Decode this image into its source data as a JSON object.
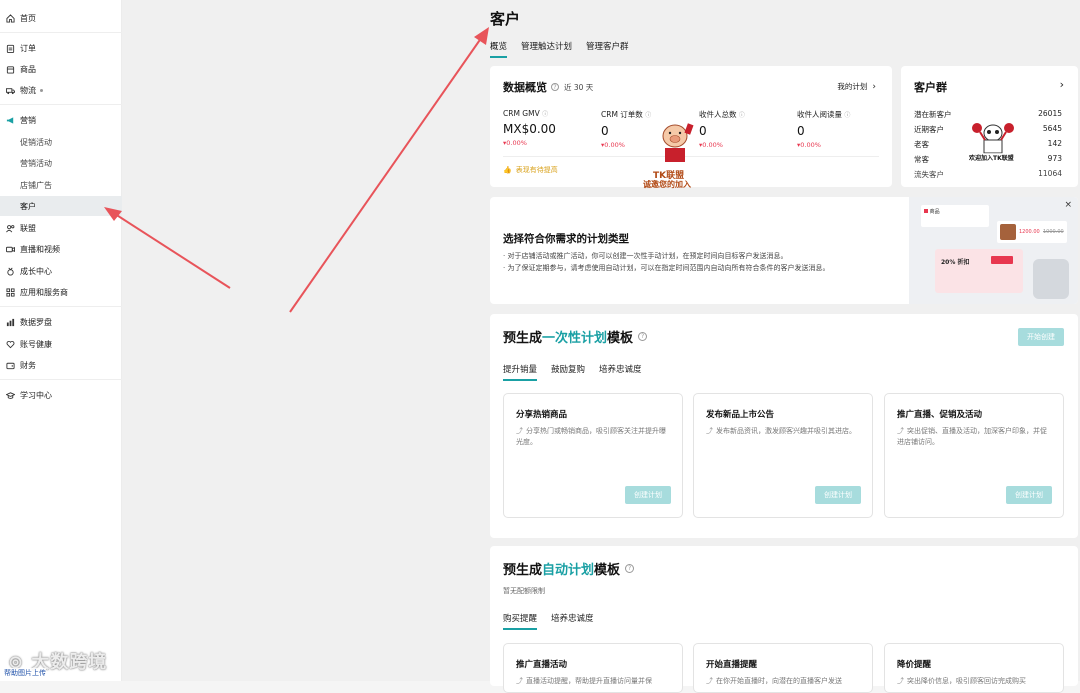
{
  "sidebar": {
    "items": [
      {
        "label": "首页",
        "icon": "home-icon"
      },
      {
        "label": "订单",
        "icon": "clipboard-icon"
      },
      {
        "label": "商品",
        "icon": "box-icon"
      },
      {
        "label": "物流",
        "icon": "truck-icon"
      },
      {
        "label": "营销",
        "icon": "megaphone-icon"
      },
      {
        "label": "促销活动"
      },
      {
        "label": "营销活动"
      },
      {
        "label": "店铺广告"
      },
      {
        "label": "客户"
      },
      {
        "label": "联盟",
        "icon": "users-icon"
      },
      {
        "label": "直播和视频",
        "icon": "video-icon"
      },
      {
        "label": "成长中心",
        "icon": "medal-icon"
      },
      {
        "label": "应用和服务商",
        "icon": "apps-icon"
      },
      {
        "label": "数据罗盘",
        "icon": "chart-icon"
      },
      {
        "label": "账号健康",
        "icon": "heart-icon"
      },
      {
        "label": "财务",
        "icon": "wallet-icon"
      },
      {
        "label": "学习中心",
        "icon": "graduation-cap-icon"
      }
    ]
  },
  "page": {
    "title": "客户",
    "tabs": [
      "概览",
      "管理触达计划",
      "管理客户群"
    ]
  },
  "overview": {
    "title": "数据概览",
    "range": "近 30 天",
    "my_plan": "我的计划",
    "metrics": [
      {
        "label": "CRM GMV",
        "value": "MX$0.00",
        "delta": "0.00%"
      },
      {
        "label": "CRM 订单数",
        "value": "0",
        "delta": "0.00%"
      },
      {
        "label": "收件人总数",
        "value": "0",
        "delta": "0.00%"
      },
      {
        "label": "收件人阅读量",
        "value": "0",
        "delta": "0.00%"
      }
    ],
    "improve_note": "表现有待提高"
  },
  "segments": {
    "title": "客户群",
    "rows": [
      {
        "label": "潜在新客户",
        "value": "26015"
      },
      {
        "label": "近期客户",
        "value": "5645"
      },
      {
        "label": "老客",
        "value": "142"
      },
      {
        "label": "常客",
        "value": "973"
      },
      {
        "label": "流失客户",
        "value": "11064"
      }
    ]
  },
  "banner": {
    "title": "选择符合你需求的计划类型",
    "lines": [
      "· 对于店铺活动或推广活动，你可以创建一次性手动计划，在预定时间向目标客户发送消息。",
      "· 为了保证定期参与，请考虑使用自动计划，可以在指定时间范围内自动向所有符合条件的客户发送消息。"
    ],
    "preview": {
      "product_label": "商品",
      "price_new": "1200.00",
      "price_old": "1000.00",
      "discount": "20% 折扣"
    }
  },
  "one_time": {
    "title_prefix": "预生成",
    "title_highlight": "一次性计划",
    "title_suffix": "模板",
    "start_button": "开始创建",
    "tabs": [
      "提升销量",
      "鼓励复购",
      "培养忠诚度"
    ],
    "cards": [
      {
        "title": "分享热销商品",
        "desc": "分享热门或畅销商品，吸引顾客关注并提升曝光度。",
        "button": "创建计划"
      },
      {
        "title": "发布新品上市公告",
        "desc": "发布新品资讯，激发顾客兴趣并吸引其进店。",
        "button": "创建计划"
      },
      {
        "title": "推广直播、促销及活动",
        "desc": "突出促销、直播及活动，加深客户印象，并促进店铺访问。",
        "button": "创建计划"
      }
    ]
  },
  "auto": {
    "title_prefix": "预生成",
    "title_highlight": "自动计划",
    "title_suffix": "模板",
    "quota": "暂无配额限制",
    "tabs": [
      "购买提醒",
      "培养忠诚度"
    ],
    "cards": [
      {
        "title": "推广直播活动",
        "desc": "直播活动提醒，帮助提升直播访问量并保"
      },
      {
        "title": "开始直播提醒",
        "desc": "在你开始直播时，向潜在的直播客户发送"
      },
      {
        "title": "降价提醒",
        "desc": "突出降价信息，吸引顾客回访完成购买"
      }
    ]
  },
  "overlay": {
    "mascot1_text": "TK联盟",
    "mascot1_sub": "诚邀您的加入",
    "mascot2_text": "欢迎加入TK联盟",
    "watermark": "大数跨境",
    "upload_tag": "帮助图片上传"
  },
  "colors": {
    "accent": "#1aa0a4",
    "accent_disabled": "#a7dcdd",
    "negative": "#e8374f",
    "warning": "#d9a21b",
    "arrow": "#e8545a"
  }
}
